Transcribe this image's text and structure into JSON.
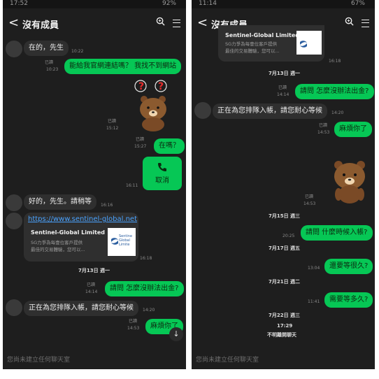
{
  "left": {
    "status": {
      "time": "17:52",
      "battery": "92%"
    },
    "header": {
      "back": "<",
      "title": "沒有成員"
    },
    "messages": {
      "m1": {
        "text": "在的，先生",
        "time": "10:22"
      },
      "m2": {
        "text": "能給我官網連結嗎？ 我找不到網站",
        "read": "已讀",
        "time": "10:23"
      },
      "m3": {
        "read": "已讀",
        "time": "15:12"
      },
      "m4": {
        "text": "在嗎？",
        "read": "已讀",
        "time": "15:27"
      },
      "m5": {
        "label": "取消",
        "time": "16:11"
      },
      "m6": {
        "text": "好的，先生。請稍等",
        "time": "16:16"
      },
      "m7": {
        "url": "https://www.sentinel-global.net",
        "title": "Sentinel-Global Limited",
        "desc1": "SG力爭為每壹位客戶提供",
        "desc2": "最佳的交易體驗，您可以...",
        "logo_text1": "Sentine",
        "logo_text2": "Global",
        "logo_text3": "Limite",
        "time": "16:18"
      },
      "date1": "7月13日 週一",
      "m8": {
        "text": "請問 怎麼沒辦法出金?",
        "read": "已讀",
        "time": "14:14"
      },
      "m9": {
        "text": "正在為您排隊入帳，請您耐心等候",
        "time": "14:20"
      },
      "m10": {
        "text": "麻煩你了",
        "read": "已讀",
        "time": "14:53"
      }
    },
    "scroll_icon": "↓",
    "input_placeholder": "您尚未建立任何聊天室"
  },
  "right": {
    "status": {
      "time": "11:14",
      "battery": "67%"
    },
    "header": {
      "back": "<",
      "title": "沒有成員"
    },
    "messages": {
      "card": {
        "title": "Sentinel-Global Limited",
        "desc1": "SG力爭為每壹位客戶提供",
        "desc2": "最佳的交易體驗，您可以...",
        "time": "16:18"
      },
      "date1": "7月13日 週一",
      "r1": {
        "text": "請問 怎麼沒辦法出金?",
        "read": "已讀",
        "time": "14:14"
      },
      "r2": {
        "text": "正在為您排隊入帳，請您耐心等候",
        "time": "14:20"
      },
      "r3": {
        "text": "麻煩你了",
        "read": "已讀",
        "time": "14:53"
      },
      "r4": {
        "read": "已讀",
        "time": "14:53"
      },
      "date2": "7月15日 週三",
      "r5": {
        "text": "請問 什麼時候入帳?",
        "time": "20:25"
      },
      "date3": "7月17日 週五",
      "r6": {
        "text": "還要等很久?",
        "time": "13:04"
      },
      "date4": "7月21日 週二",
      "r7": {
        "text": "需要等多久?",
        "time": "11:41"
      },
      "date5": "7月22日 週三",
      "sys_time": "17:29",
      "sys_text": "不明離開聊天"
    },
    "input_placeholder": "您尚未建立任何聊天室"
  },
  "colors": {
    "bubble_out": "#06c755",
    "bubble_in": "#2f2f2f",
    "background": "#1e1e1e",
    "link": "#4aa3ff"
  }
}
